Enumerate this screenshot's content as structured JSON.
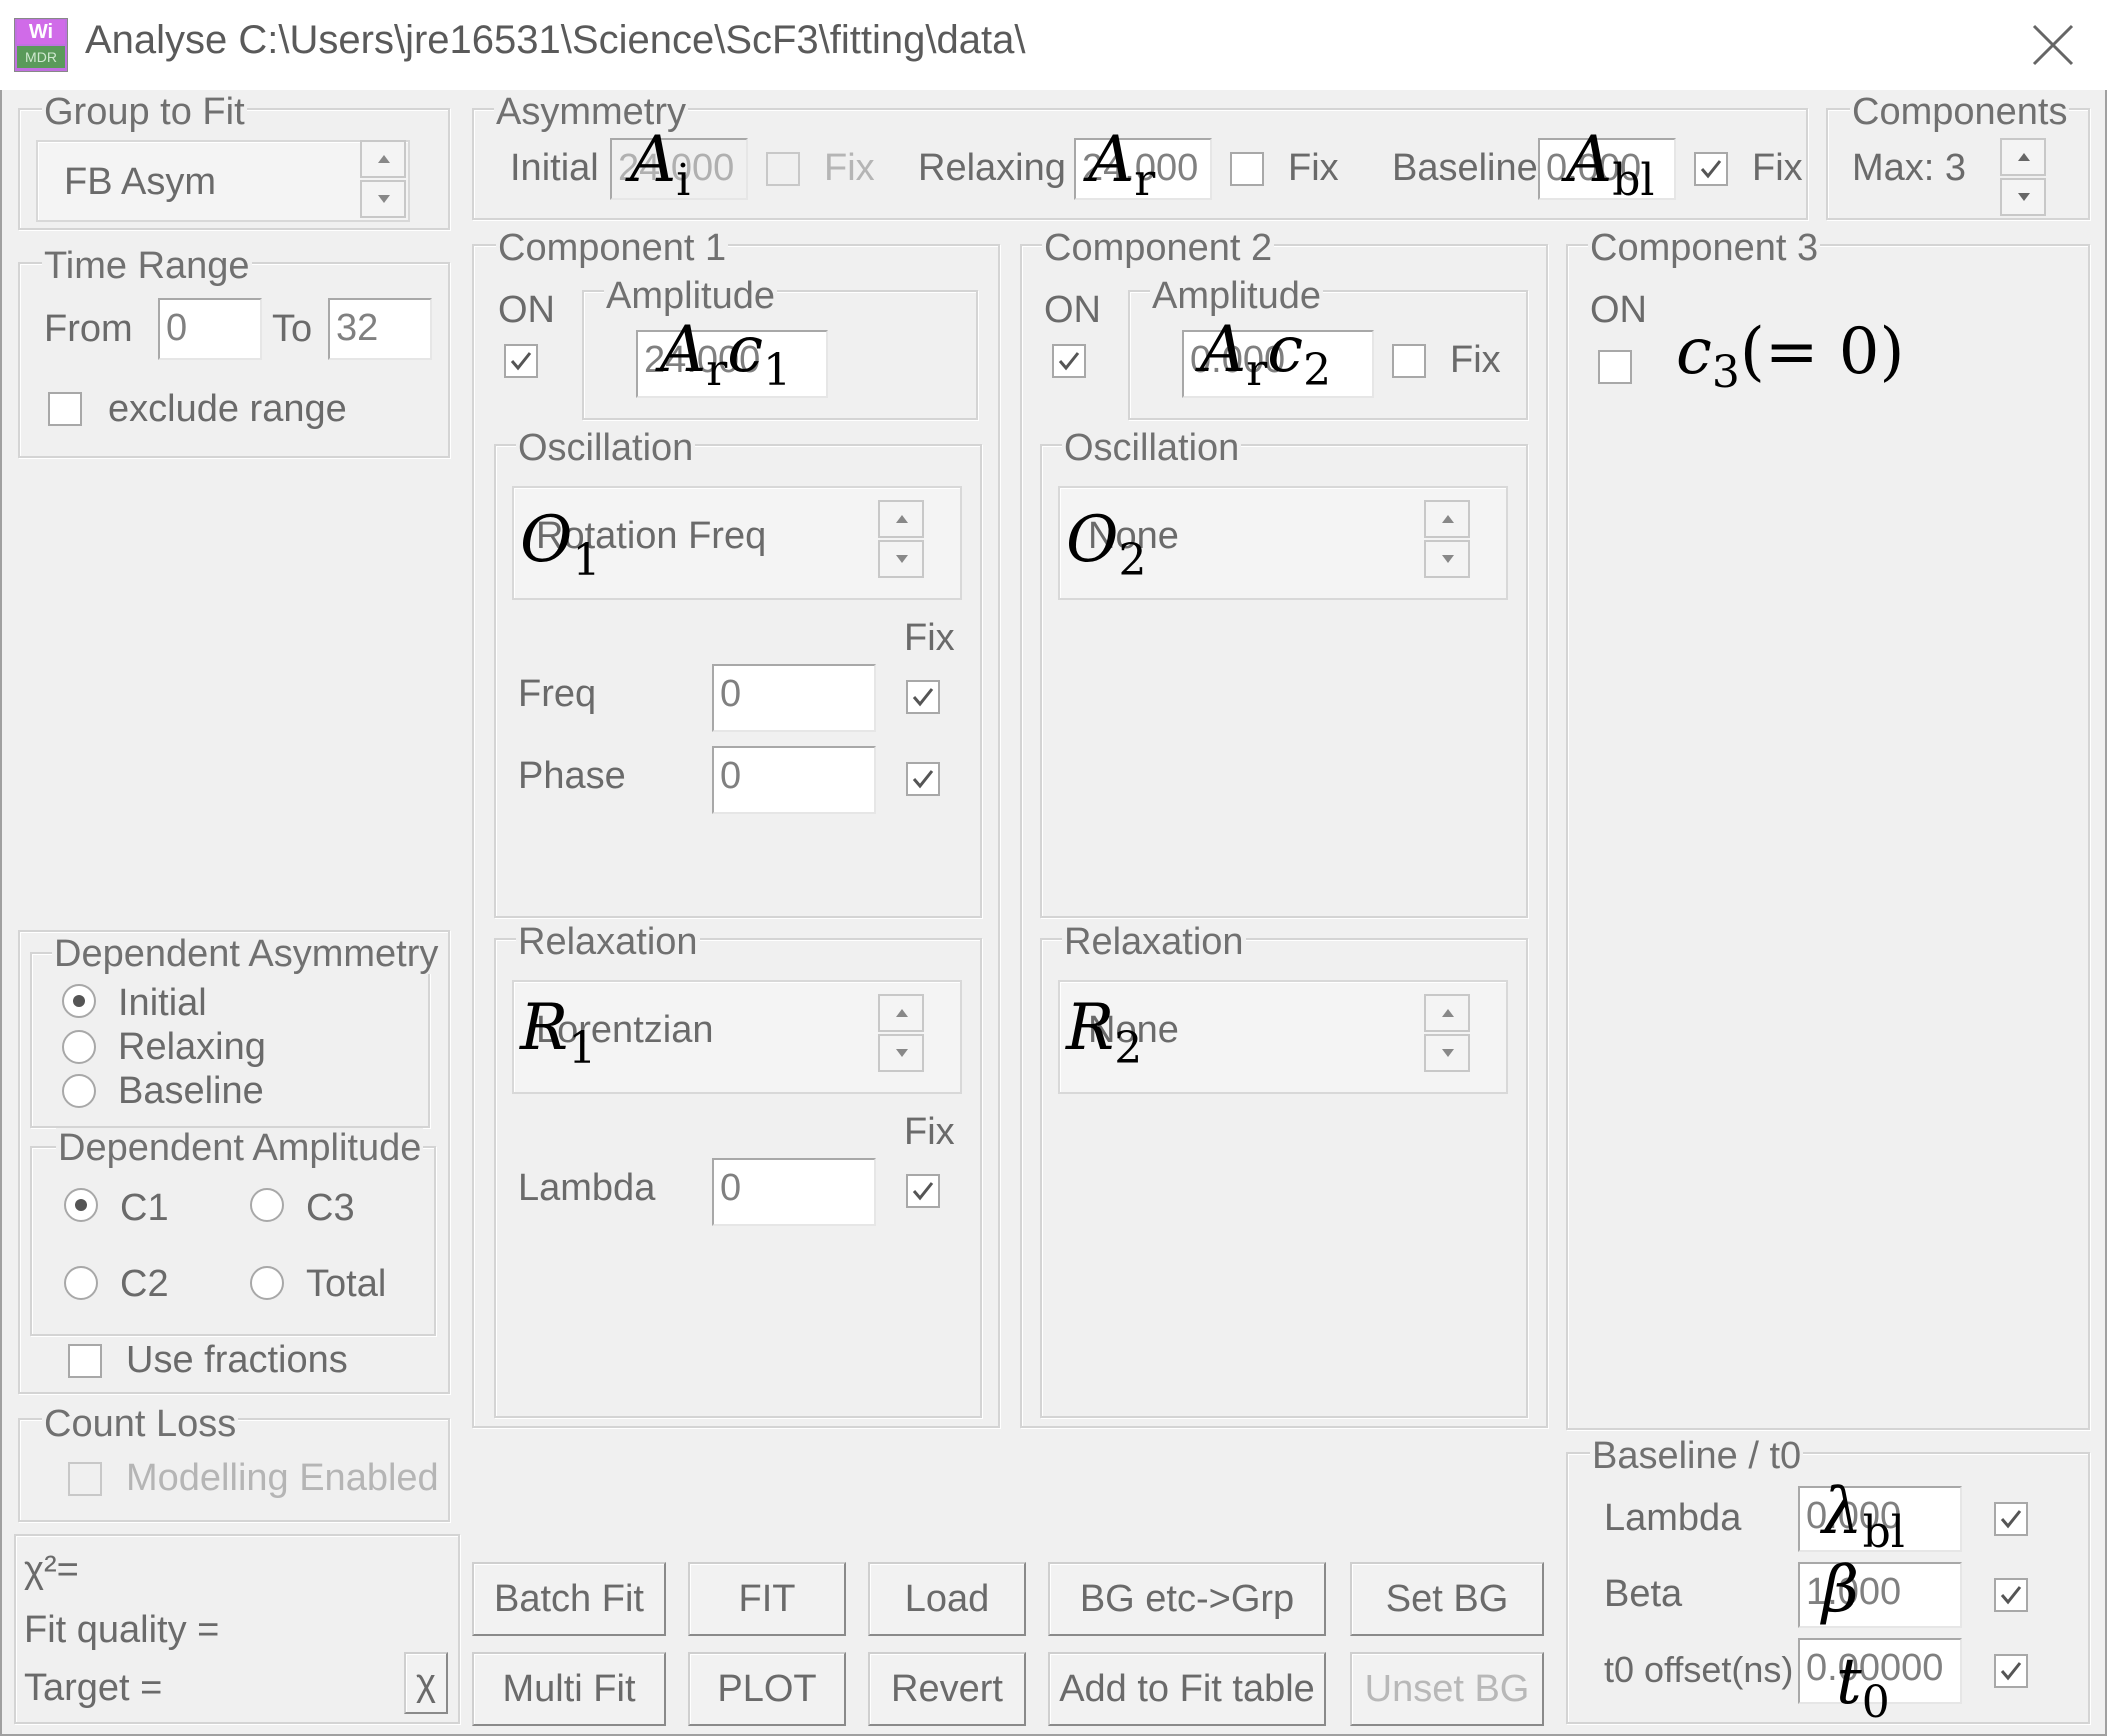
{
  "window": {
    "app_icon_top": "Wi",
    "app_icon_bottom": "MDR",
    "title": "Analyse C:\\Users\\jre16531\\Science\\ScF3\\fitting\\data\\"
  },
  "group_to_fit": {
    "title": "Group to Fit",
    "value": "FB Asym"
  },
  "time_range": {
    "title": "Time Range",
    "from_label": "From",
    "from_value": "0",
    "to_label": "To",
    "to_value": "32",
    "exclude_label": "exclude range"
  },
  "asymmetry": {
    "title": "Asymmetry",
    "initial_label": "Initial",
    "initial_value": "24.000",
    "relaxing_label": "Relaxing",
    "relaxing_value": "24.000",
    "baseline_label": "Baseline",
    "baseline_value": "0.000",
    "fix_label": "Fix"
  },
  "components": {
    "title": "Components",
    "max_label": "Max: 3"
  },
  "component1": {
    "title": "Component 1",
    "on_label": "ON",
    "amplitude_title": "Amplitude",
    "amplitude_value": "24.000",
    "oscillation_title": "Oscillation",
    "oscillation_value": "Rotation Freq",
    "fix_label": "Fix",
    "freq_label": "Freq",
    "freq_value": "0",
    "phase_label": "Phase",
    "phase_value": "0",
    "relaxation_title": "Relaxation",
    "relaxation_value": "Lorentzian",
    "lambda_label": "Lambda",
    "lambda_value": "0"
  },
  "component2": {
    "title": "Component 2",
    "on_label": "ON",
    "amplitude_title": "Amplitude",
    "amplitude_value": "0.000",
    "fix_label": "Fix",
    "oscillation_title": "Oscillation",
    "oscillation_value": "None",
    "relaxation_title": "Relaxation",
    "relaxation_value": "None"
  },
  "component3": {
    "title": "Component 3",
    "on_label": "ON"
  },
  "dependent_asymmetry": {
    "title": "Dependent Asymmetry",
    "options": [
      "Initial",
      "Relaxing",
      "Baseline"
    ]
  },
  "dependent_amplitude": {
    "title": "Dependent Amplitude",
    "c1": "C1",
    "c3": "C3",
    "c2": "C2",
    "total": "Total",
    "use_fractions": "Use fractions"
  },
  "count_loss": {
    "title": "Count Loss",
    "modelling": "Modelling Enabled"
  },
  "status": {
    "chi2": "χ²=",
    "fit_quality": "Fit quality =",
    "target": "Target =",
    "chi_button": "χ"
  },
  "buttons": {
    "batch_fit": "Batch Fit",
    "fit": "FIT",
    "load": "Load",
    "bg_etc": "BG etc->Grp",
    "set_bg": "Set BG",
    "multi_fit": "Multi Fit",
    "plot": "PLOT",
    "revert": "Revert",
    "add_to_fit_table": "Add to Fit table",
    "unset_bg": "Unset BG"
  },
  "baseline_t0": {
    "title": "Baseline / t0",
    "lambda_label": "Lambda",
    "lambda_value": "0.000",
    "beta_label": "Beta",
    "beta_value": "1.000",
    "t0_label": "t0 offset(ns)",
    "t0_value": "0.00000"
  },
  "annotations": {
    "A_i": {
      "base": "A",
      "sub": "i"
    },
    "A_r": {
      "base": "A",
      "sub": "r"
    },
    "A_bl": {
      "base": "A",
      "sub": "bl"
    },
    "Arc1": {
      "base": "A",
      "sub1": "r",
      "mid": "c",
      "sub2": "1"
    },
    "Arc2": {
      "base": "A",
      "sub1": "r",
      "mid": "c",
      "sub2": "2"
    },
    "c3": {
      "base": "c",
      "sub": "3",
      "tail": "(= 0)"
    },
    "O1": {
      "base": "O",
      "sub": "1"
    },
    "O2": {
      "base": "O",
      "sub": "2"
    },
    "R1": {
      "base": "R",
      "sub": "1"
    },
    "R2": {
      "base": "R",
      "sub": "2"
    },
    "lambda_bl": {
      "base": "λ",
      "sub": "bl"
    },
    "beta": {
      "base": "β"
    },
    "t0": {
      "base": "t",
      "sub": "0"
    }
  }
}
